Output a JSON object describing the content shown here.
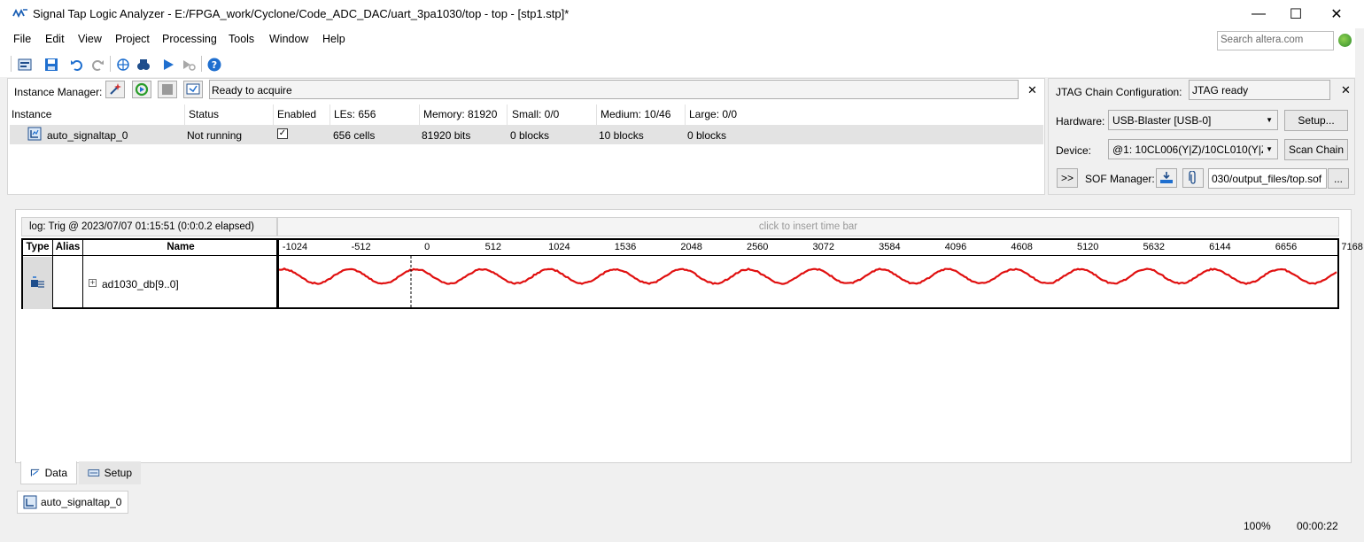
{
  "window": {
    "title": "Signal Tap Logic Analyzer - E:/FPGA_work/Cyclone/Code_ADC_DAC/uart_3pa1030/top - top - [stp1.stp]*",
    "minimize": "—",
    "maximize": "☐",
    "close": "✕"
  },
  "menu": {
    "items": [
      "File",
      "Edit",
      "View",
      "Project",
      "Processing",
      "Tools",
      "Window",
      "Help"
    ],
    "search_placeholder": "Search altera.com"
  },
  "instance_manager": {
    "label": "Instance Manager:",
    "status": "Ready to acquire",
    "columns": [
      "Instance",
      "Status",
      "Enabled",
      "LEs: 656",
      "Memory: 81920",
      "Small: 0/0",
      "Medium: 10/46",
      "Large: 0/0"
    ],
    "row": {
      "instance": "auto_signaltap_0",
      "status": "Not running",
      "enabled": true,
      "les": "656 cells",
      "memory": "81920 bits",
      "small": "0 blocks",
      "medium": "10 blocks",
      "large": "0 blocks"
    }
  },
  "jtag": {
    "label": "JTAG Chain Configuration:",
    "status": "JTAG ready",
    "hardware_label": "Hardware:",
    "hardware_value": "USB-Blaster [USB-0]",
    "setup_button": "Setup...",
    "device_label": "Device:",
    "device_value": "@1: 10CL006(Y|Z)/10CL010(Y|Z",
    "scan_chain_button": "Scan Chain",
    "expand_button": ">>",
    "sof_label": "SOF Manager:",
    "sof_path": "030/output_files/top.sof",
    "browse_button": "..."
  },
  "waveform": {
    "log": "log: Trig @ 2023/07/07 01:15:51 (0:0:0.2 elapsed)",
    "time_bar_hint": "click to insert time bar",
    "headers": {
      "type": "Type",
      "alias": "Alias",
      "name": "Name"
    },
    "signal_name": "ad1030_db[9..0]",
    "expand": "+",
    "ticks": [
      "-1024",
      "-512",
      "0",
      "512",
      "1024",
      "1536",
      "2048",
      "2560",
      "3072",
      "3584",
      "4096",
      "4608",
      "5120",
      "5632",
      "6144",
      "6656",
      "7168"
    ],
    "wave_color": "#e01010"
  },
  "tabs": {
    "data": "Data",
    "setup": "Setup"
  },
  "bottom_tab": "auto_signaltap_0",
  "statusbar": {
    "zoom": "100%",
    "time": "00:00:22"
  }
}
